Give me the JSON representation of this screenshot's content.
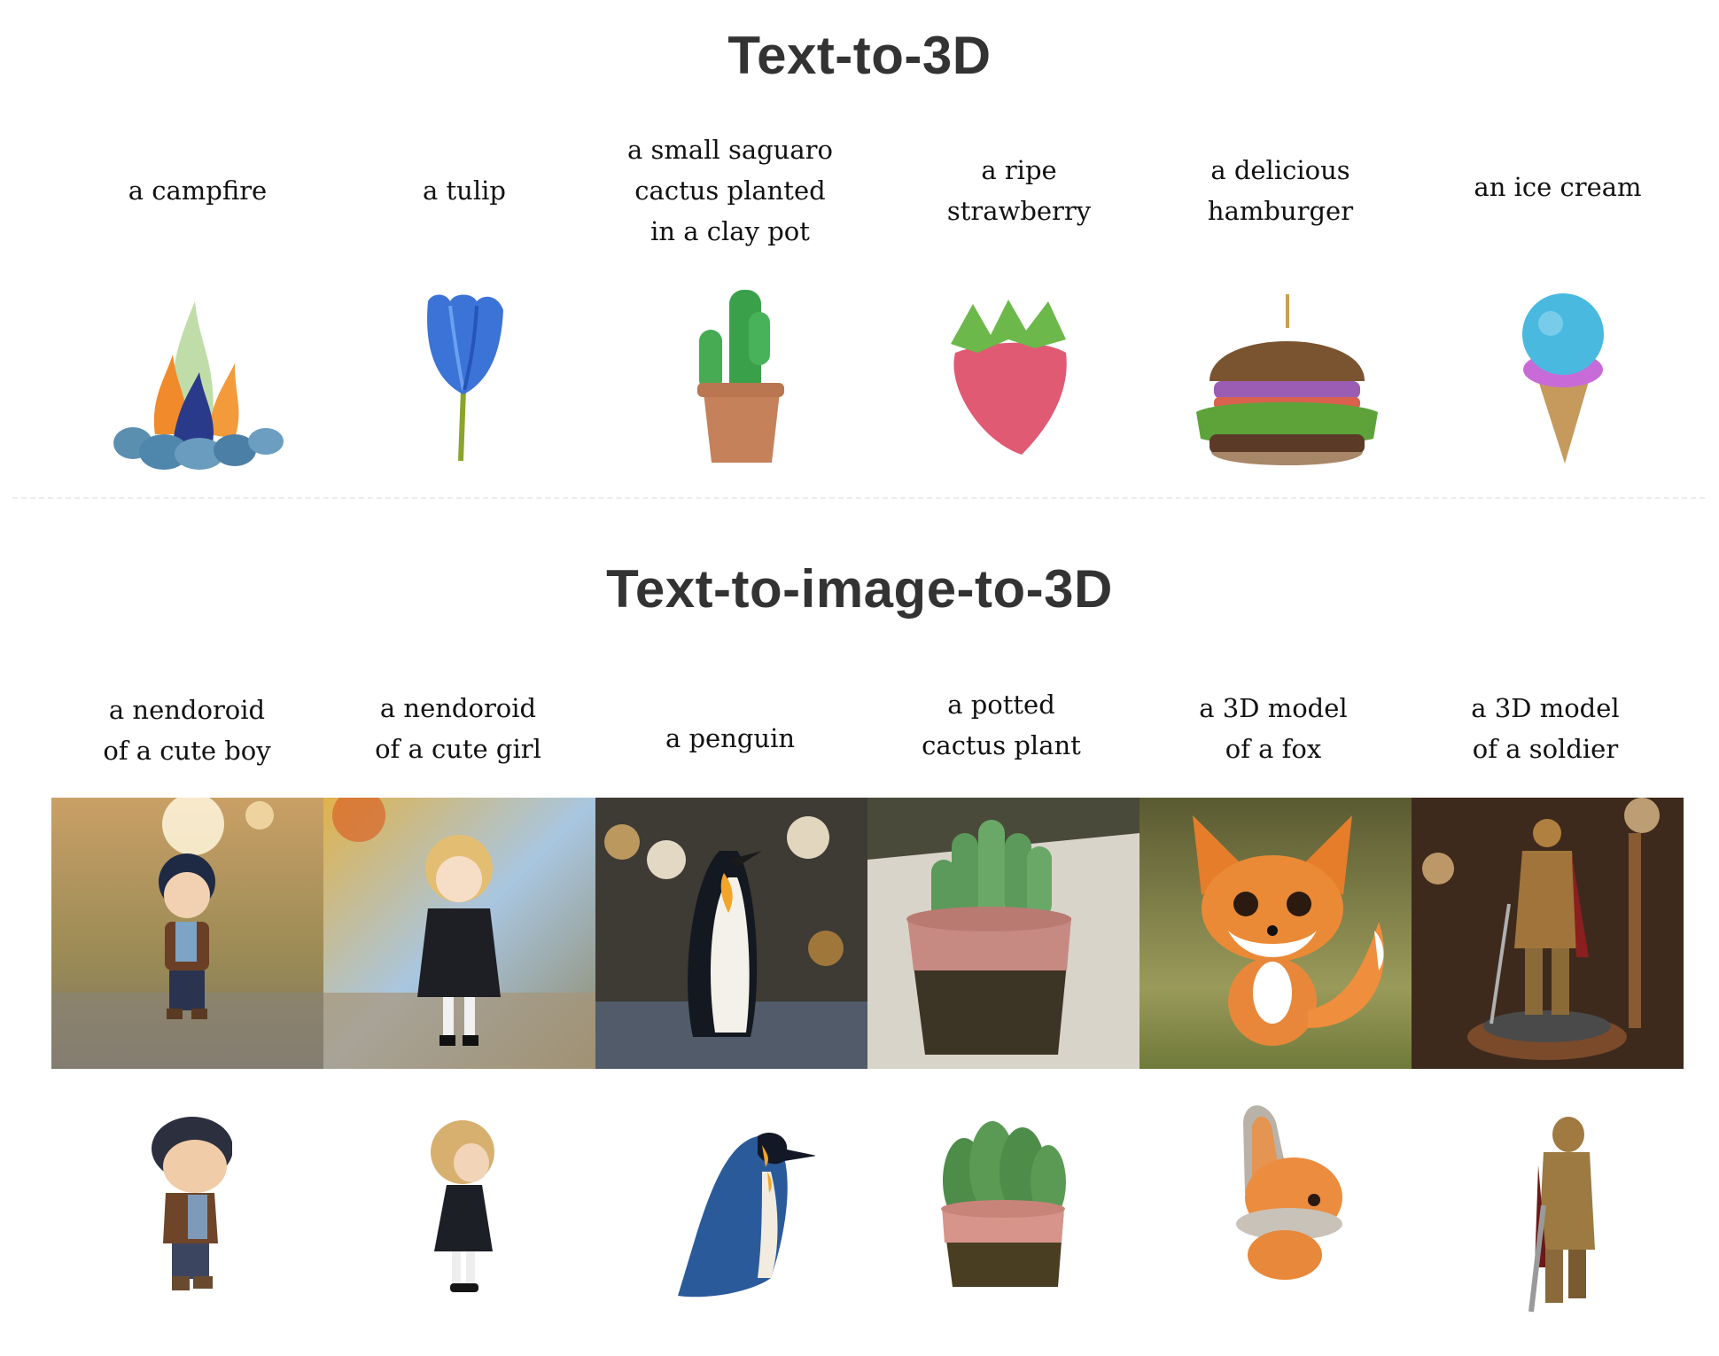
{
  "sections": [
    {
      "title": "Text-to-3D",
      "items": [
        {
          "prompt_lines": [
            "a campfire"
          ],
          "render": "campfire-3d"
        },
        {
          "prompt_lines": [
            "a tulip"
          ],
          "render": "tulip-3d"
        },
        {
          "prompt_lines": [
            "a small saguaro",
            "cactus planted",
            "in a clay pot"
          ],
          "render": "saguaro-cactus-3d"
        },
        {
          "prompt_lines": [
            "a ripe",
            "strawberry"
          ],
          "render": "strawberry-3d"
        },
        {
          "prompt_lines": [
            "a delicious",
            "hamburger"
          ],
          "render": "hamburger-3d"
        },
        {
          "prompt_lines": [
            "an ice cream"
          ],
          "render": "ice-cream-3d"
        }
      ]
    },
    {
      "title": "Text-to-image-to-3D",
      "items": [
        {
          "prompt_lines": [
            "a nendoroid",
            "of a cute boy"
          ],
          "image": "boy-figure-photo",
          "render": "boy-figure-3d"
        },
        {
          "prompt_lines": [
            "a nendoroid",
            "of a cute girl"
          ],
          "image": "girl-figure-photo",
          "render": "girl-figure-3d"
        },
        {
          "prompt_lines": [
            "a penguin"
          ],
          "image": "penguin-photo",
          "render": "penguin-3d"
        },
        {
          "prompt_lines": [
            "a potted",
            "cactus plant"
          ],
          "image": "potted-cactus-photo",
          "render": "potted-cactus-3d"
        },
        {
          "prompt_lines": [
            "a 3D model",
            "of a fox"
          ],
          "image": "fox-photo",
          "render": "fox-3d"
        },
        {
          "prompt_lines": [
            "a 3D model",
            "of a soldier"
          ],
          "image": "soldier-photo",
          "render": "soldier-3d"
        }
      ]
    }
  ]
}
